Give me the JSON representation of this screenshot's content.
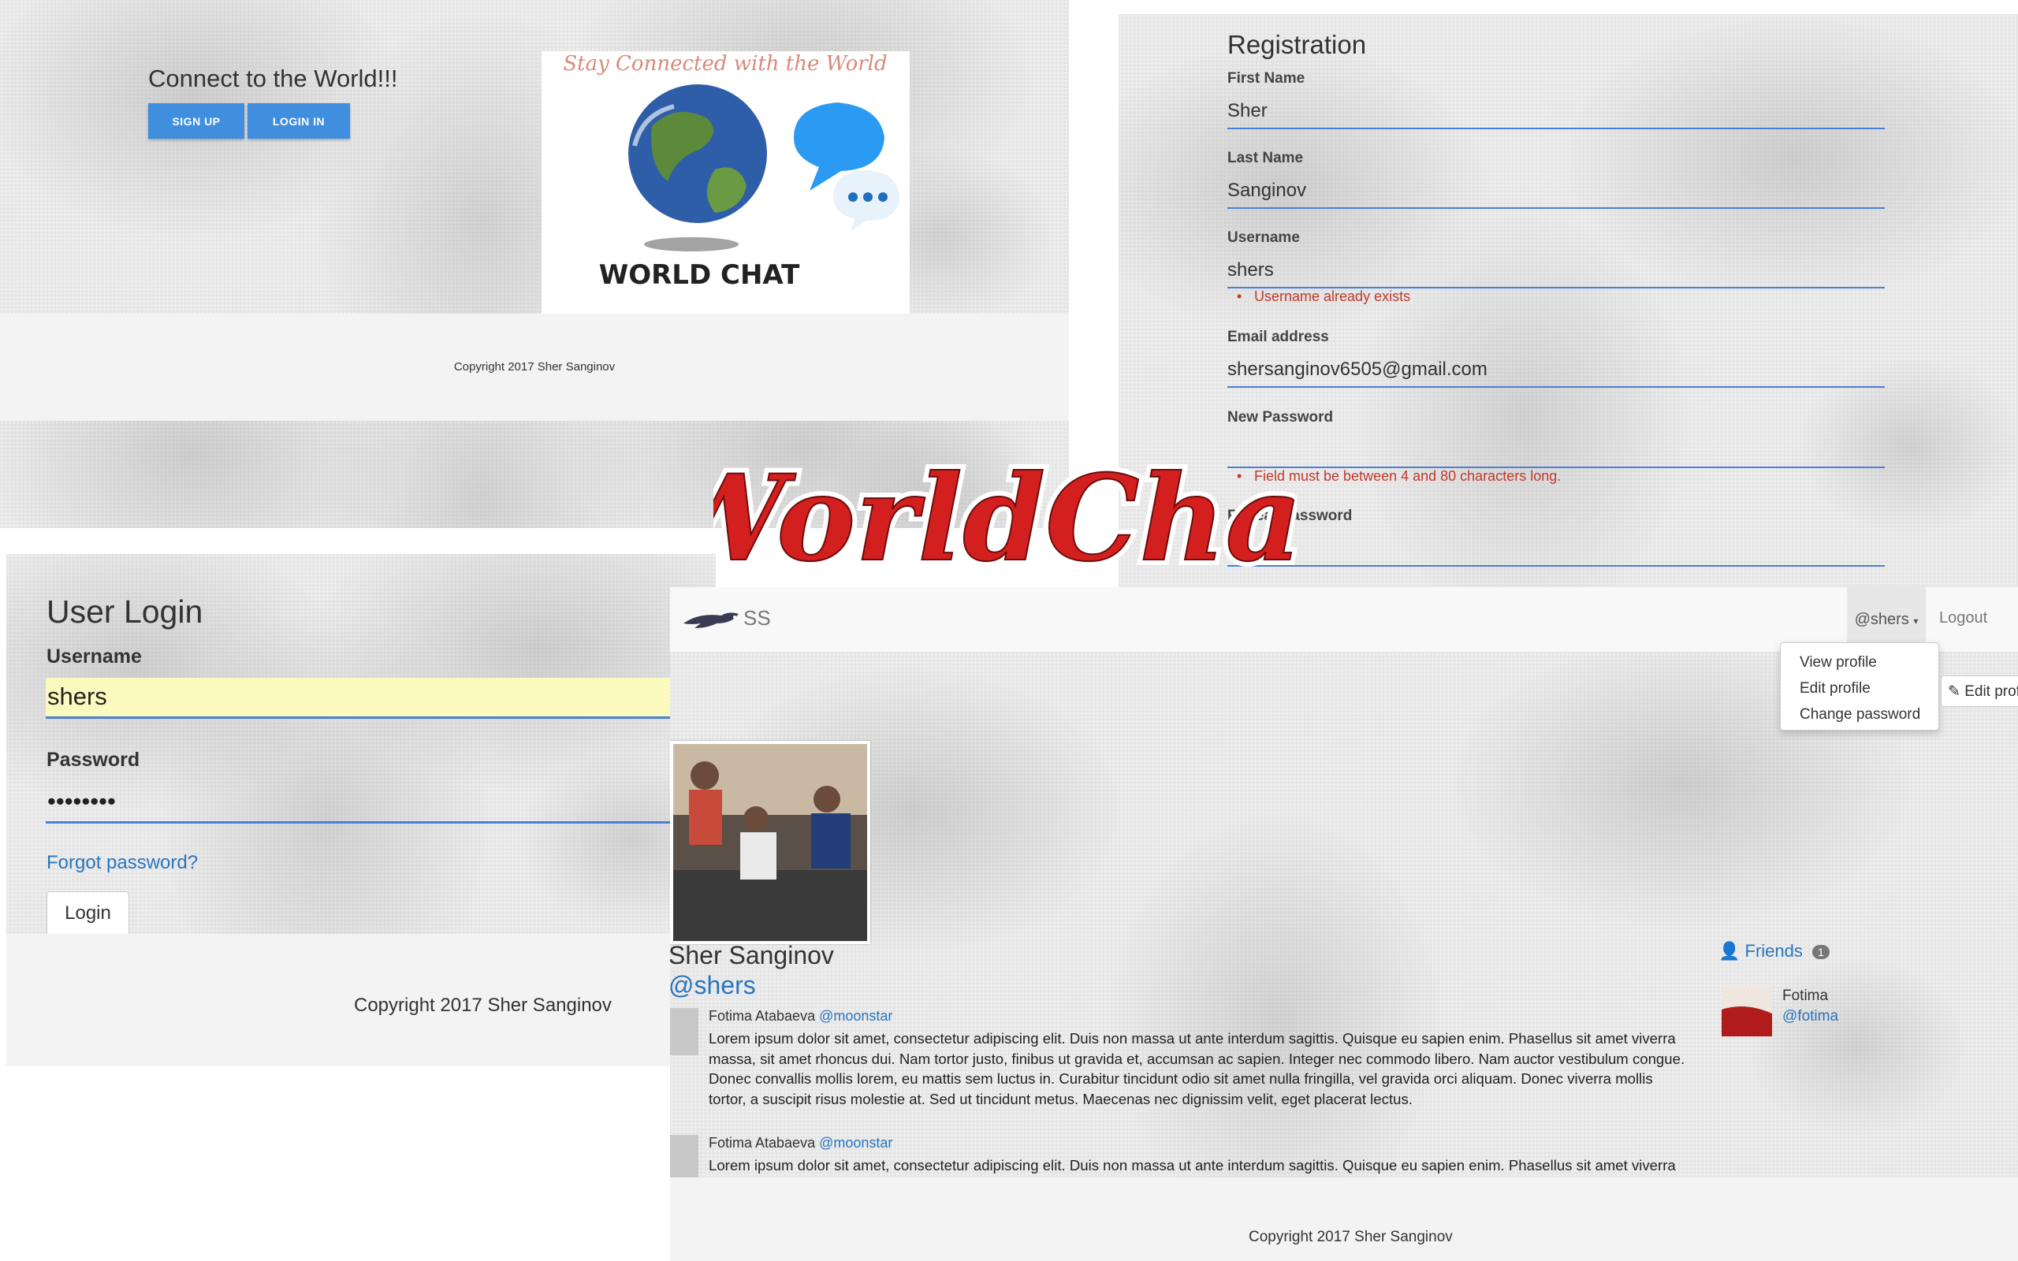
{
  "overlay_title": "WorldChat",
  "landing": {
    "tagline": "Connect to the World!!!",
    "signup_label": "SIGN UP",
    "login_label": "LOGIN IN",
    "logo_tagline": "Stay Connected with the World",
    "logo_text": "WORLD CHAT",
    "copyright": "Copyright 2017 Sher Sanginov"
  },
  "register": {
    "title": "Registration",
    "fields": [
      {
        "label": "First Name",
        "value": "Sher"
      },
      {
        "label": "Last Name",
        "value": "Sanginov"
      },
      {
        "label": "Username",
        "value": "shers",
        "error": "Username already exists"
      },
      {
        "label": "Email address",
        "value": "shersanginov6505@gmail.com"
      },
      {
        "label": "New Password",
        "value": "",
        "error": "Field must be between 4 and 80 characters long."
      },
      {
        "label": "Repeat Password",
        "value": ""
      }
    ]
  },
  "login": {
    "title": "User Login",
    "username_label": "Username",
    "username_value": "shers",
    "password_label": "Password",
    "password_value": "••••••••",
    "forgot": "Forgot password?",
    "button": "Login",
    "copyright": "Copyright 2017 Sher Sanginov"
  },
  "profile": {
    "brand": "SS",
    "nav_user": "@shers",
    "logout": "Logout",
    "dropdown": [
      "View profile",
      "Edit profile",
      "Change password"
    ],
    "edit_button": "Edit profi",
    "name": "Sher Sanginov",
    "handle": "@shers",
    "posts": [
      {
        "author": "Fotima Atabaeva",
        "handle": "@moonstar",
        "text": "Lorem ipsum dolor sit amet, consectetur adipiscing elit. Duis non massa ut ante interdum sagittis. Quisque eu sapien enim. Phasellus sit amet viverra massa, sit amet rhoncus dui. Nam tortor justo, finibus ut gravida et, accumsan ac sapien. Integer nec commodo libero. Nam auctor vestibulum congue. Donec convallis mollis lorem, eu mattis sem luctus in. Curabitur tincidunt odio sit amet nulla fringilla, vel gravida orci aliquam. Donec viverra mollis tortor, a suscipit risus molestie at. Sed ut tincidunt metus. Maecenas nec dignissim velit, eget placerat lectus."
      },
      {
        "author": "Fotima Atabaeva",
        "handle": "@moonstar",
        "text": "Lorem ipsum dolor sit amet, consectetur adipiscing elit. Duis non massa ut ante interdum sagittis. Quisque eu sapien enim. Phasellus sit amet viverra massa, sit amet rhoncus dui. Nam tortor justo, finibus ut gravida et, accumsan ac sapien. Integer nec commodo libero. Nam auctor vestibulum congue. Donec convallis mollis lorem, eu mattis sem luctus in. Curabitur tincidunt odio sit amet nulla fringilla, vel gravida orci aliquam. Donec viverra mollis tortor, a suscipit risus molestie at. Sed ut tincidunt metus. Maecenas nec dignissim velit, eget placerat lectus."
      }
    ],
    "friends_label": "Friends",
    "friends_count": "1",
    "friend_name": "Fotima",
    "friend_handle": "@fotima",
    "copyright": "Copyright 2017 Sher Sanginov"
  },
  "colors": {
    "accent_blue": "#3f8fde",
    "link_blue": "#2a75bd",
    "error_red": "#c0392b",
    "title_red": "#d41f1f"
  }
}
